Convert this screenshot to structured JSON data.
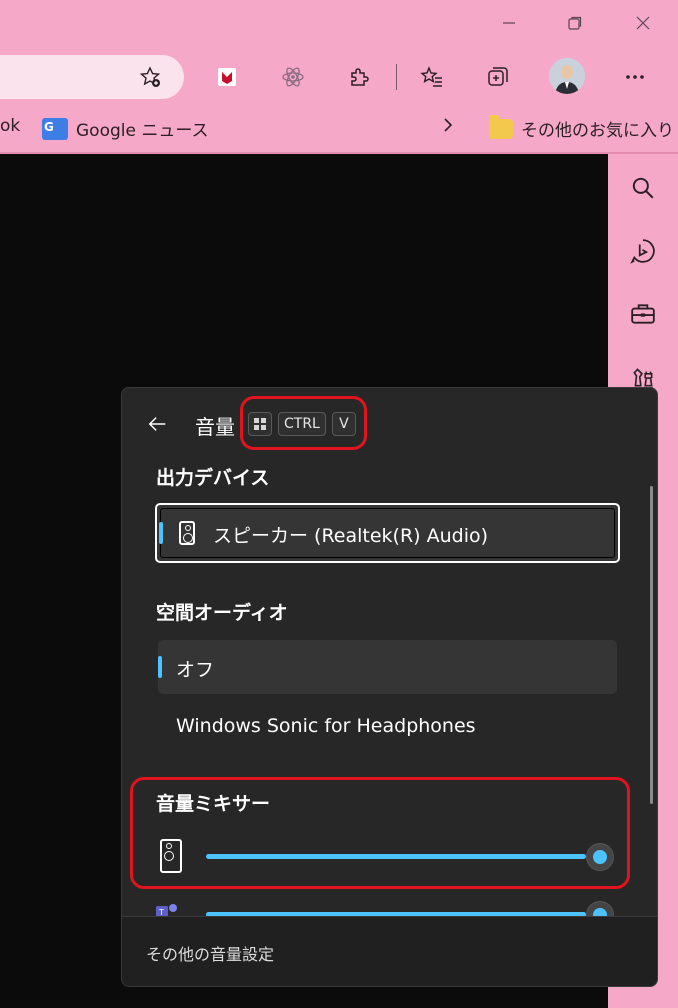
{
  "browser": {
    "bookmarks": {
      "partial_left": "ok",
      "google_news": "Google ニュース",
      "other_favorites": "その他のお気に入り"
    }
  },
  "volume_flyout": {
    "title": "音量",
    "shortcut_keys": [
      "CTRL",
      "V"
    ],
    "output_device_label": "出力デバイス",
    "output_device": "スピーカー (Realtek(R) Audio)",
    "spatial_audio_label": "空間オーディオ",
    "spatial_audio_options": [
      "オフ",
      "Windows Sonic for Headphones"
    ],
    "spatial_audio_selected": "オフ",
    "mixer_label": "音量ミキサー",
    "mixer_levels": [
      1.0,
      1.0
    ],
    "footer_link": "その他の音量設定"
  },
  "colors": {
    "accent": "#4cc2ff",
    "chrome_pink": "#f5a8c8",
    "annotation_red": "#e0141e"
  }
}
